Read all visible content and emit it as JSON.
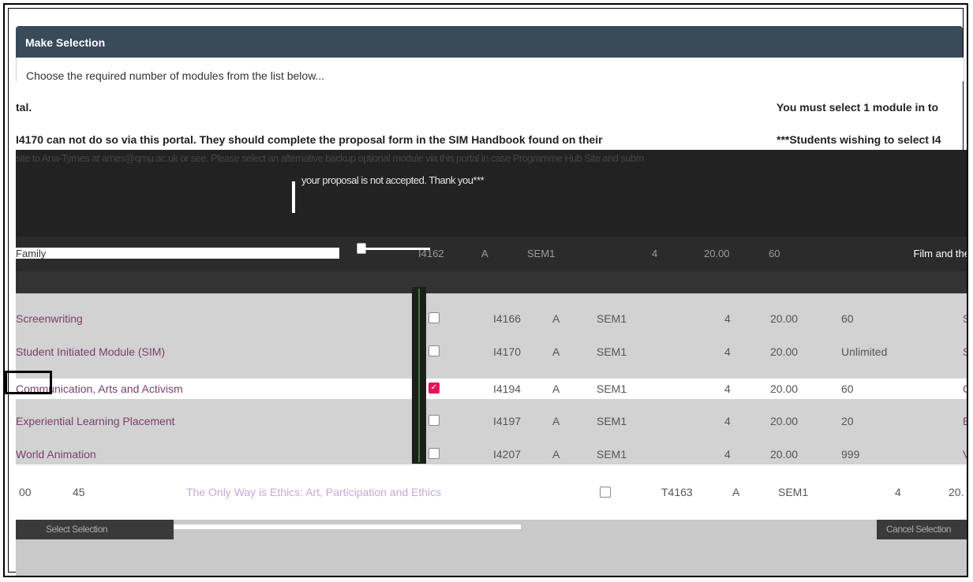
{
  "panel": {
    "title": "Make Selection",
    "instruction": "Choose the required number of modules from the list below..."
  },
  "notices": {
    "left_1": "tal.",
    "right_1": "You must select 1 module in to",
    "left_2": "I4170 can not do so via this portal. They should complete the proposal form in the SIM Handbook found on their",
    "right_2": "***Students wishing to select I4",
    "band_line1": "site to Ana-Tymes at ames@qmu.ac.uk or see. Please select an alternative backup optional module via this portal in case Programme Hub Site and subm",
    "band_line2": "your proposal is not accepted. Thank you***"
  },
  "dark_row": {
    "name": "Family",
    "code": "I4162",
    "occ": "A",
    "period": "SEM1",
    "level": "4",
    "credits": "20.00",
    "capacity": "60",
    "tail": "Film and the"
  },
  "modules": [
    {
      "name": "Screenwriting",
      "code": "I4166",
      "occ": "A",
      "period": "SEM1",
      "level": "4",
      "credits": "20.00",
      "capacity": "60",
      "checked": false,
      "extra": "S"
    },
    {
      "name": "Student Initiated Module (SIM)",
      "code": "I4170",
      "occ": "A",
      "period": "SEM1",
      "level": "4",
      "credits": "20.00",
      "capacity": "Unlimited",
      "checked": false,
      "extra": "S"
    },
    {
      "name": "Communication, Arts and Activism",
      "code": "I4194",
      "occ": "A",
      "period": "SEM1",
      "level": "4",
      "credits": "20.00",
      "capacity": "60",
      "checked": true,
      "extra": "C"
    },
    {
      "name": "Experiential Learning Placement",
      "code": "I4197",
      "occ": "A",
      "period": "SEM1",
      "level": "4",
      "credits": "20.00",
      "capacity": "20",
      "checked": false,
      "extra": "E"
    },
    {
      "name": "World Animation",
      "code": "I4207",
      "occ": "A",
      "period": "SEM1",
      "level": "4",
      "credits": "20.00",
      "capacity": "999",
      "checked": false,
      "extra": "V"
    }
  ],
  "bottom_row": {
    "credits": "00",
    "capacity": "45",
    "name": "The Only Way is Ethics: Art, Participation and Ethics",
    "code": "T4163",
    "occ": "A",
    "period": "SEM1",
    "level": "4",
    "credits2": "20."
  },
  "footer": {
    "left_label": "Select Selection",
    "right_label": "Cancel Selection"
  },
  "colors": {
    "header_bg": "#394a59",
    "module_link": "#7a3f6b",
    "checkbox_checked": "#e4135e"
  }
}
